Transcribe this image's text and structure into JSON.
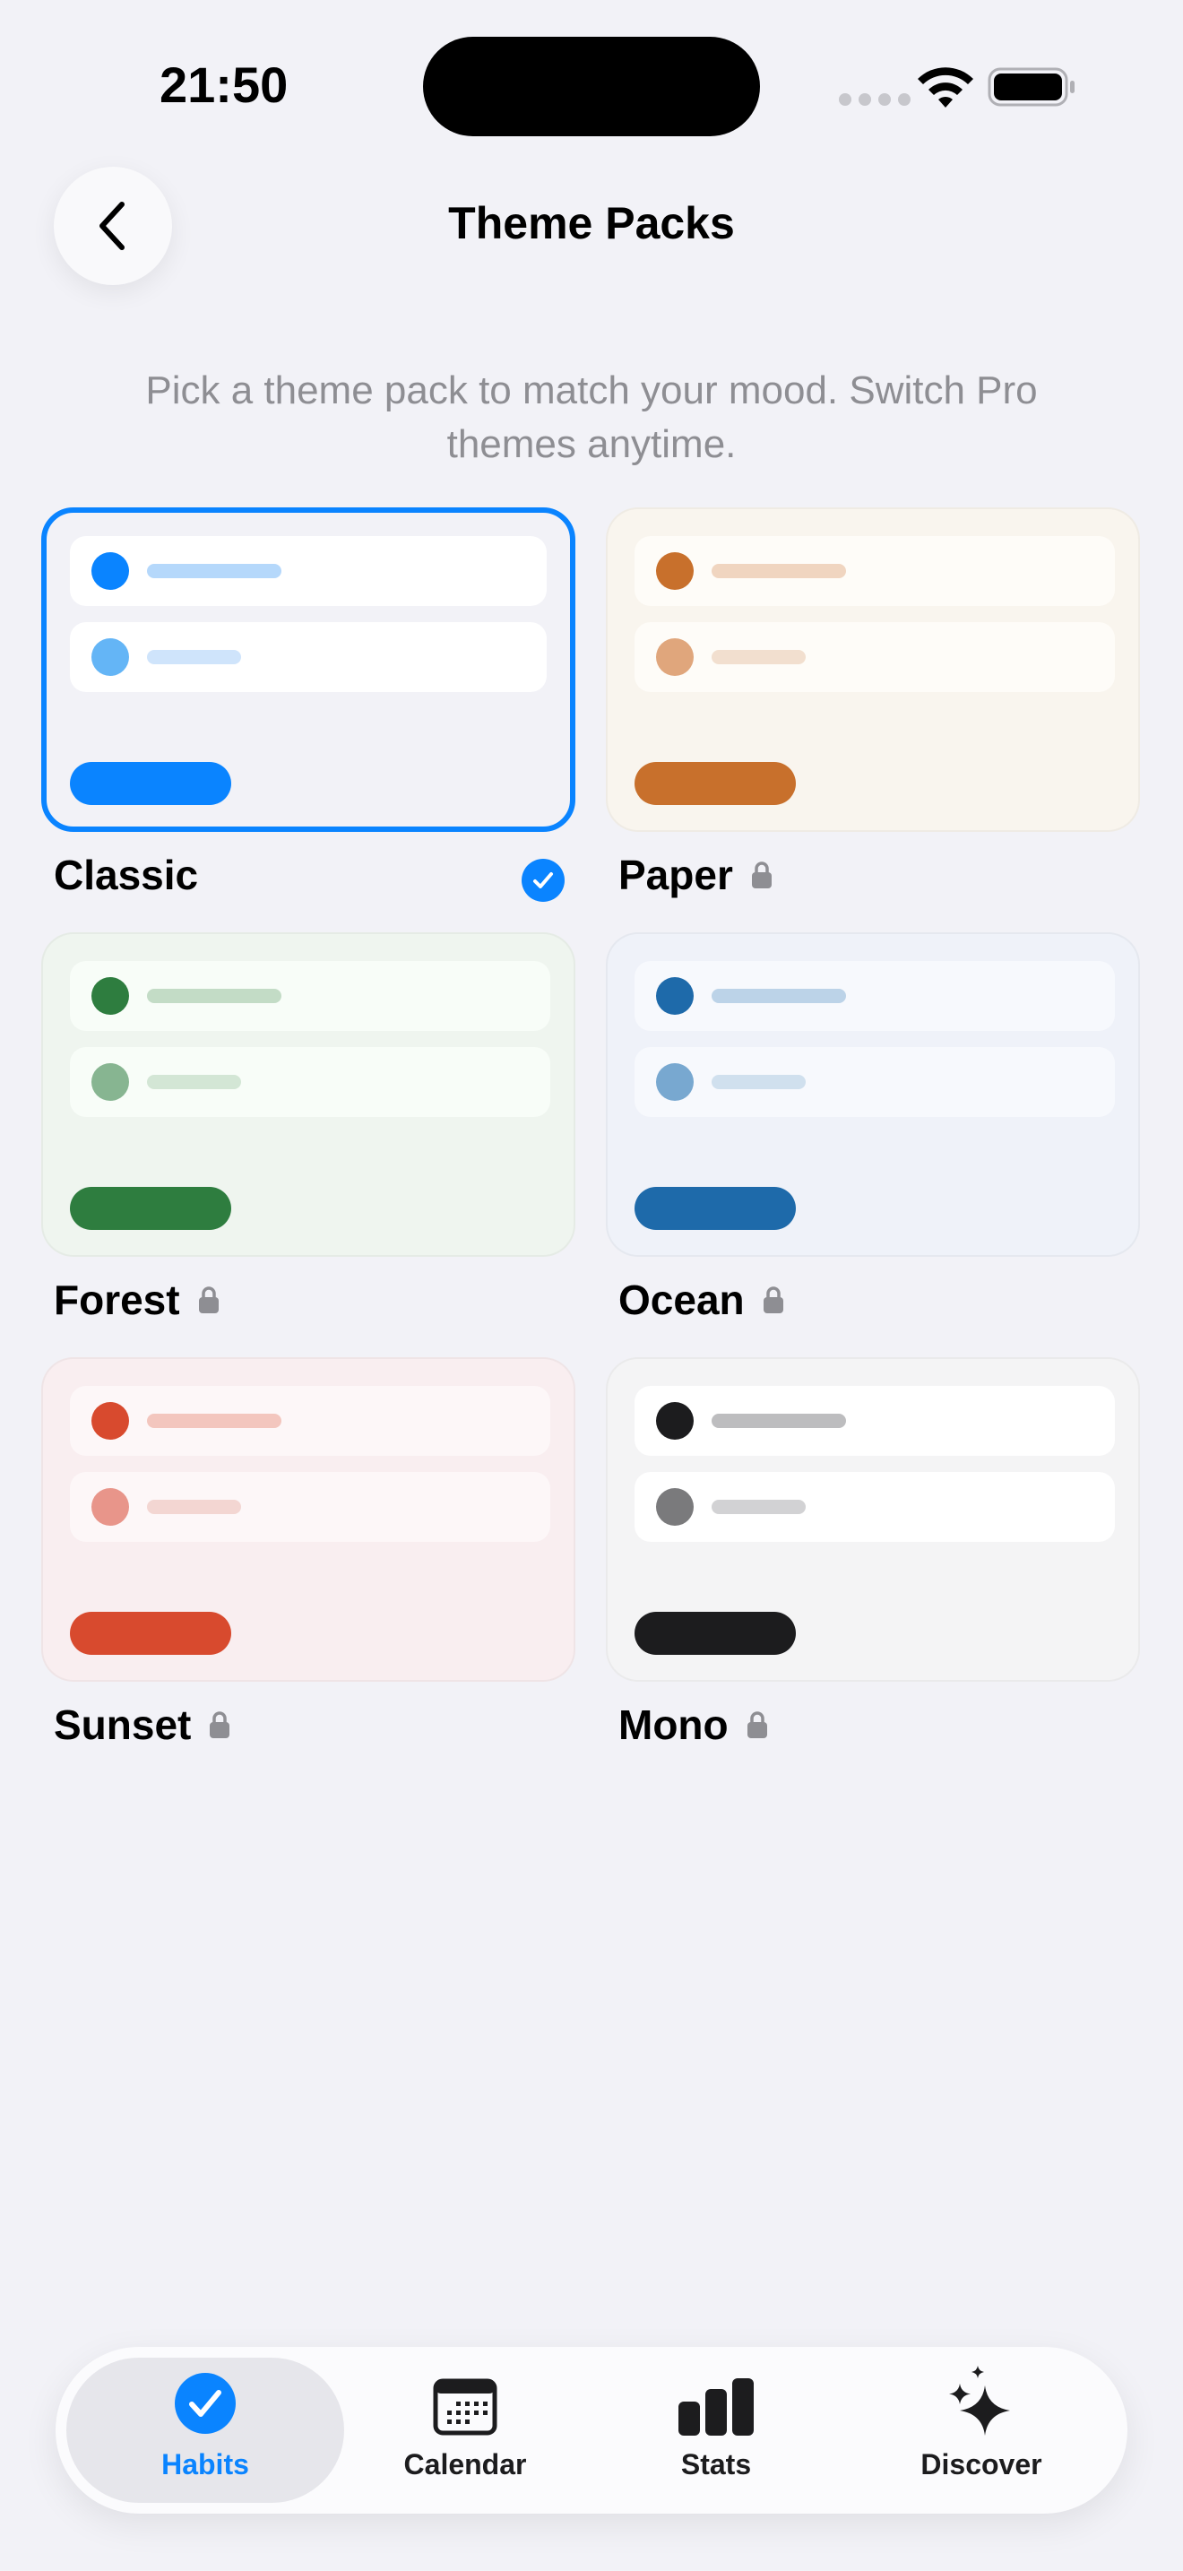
{
  "status_bar": {
    "time": "21:50"
  },
  "header": {
    "title": "Theme Packs",
    "back_icon": "chevron-left-icon"
  },
  "subtitle": "Pick a theme pack to match your mood. Switch Pro themes anytime.",
  "colors": {
    "accent": "#0a84ff",
    "background": "#f2f2f7",
    "lock": "#8e8e93"
  },
  "themes": [
    {
      "name": "Classic",
      "selected": true,
      "locked": false,
      "colors": {
        "card": "#f2f2f7",
        "row": "#ffffff",
        "dot1": "#0a84ff",
        "bar1": "#b5d8fb",
        "dot2": "#64b5f6",
        "bar2": "#cfe4fb",
        "pill": "#0a84ff"
      }
    },
    {
      "name": "Paper",
      "selected": false,
      "locked": true,
      "colors": {
        "card": "#f9f5ee",
        "row": "#fefcf8",
        "dot1": "#c8702c",
        "bar1": "#f0d5c0",
        "dot2": "#e0a67c",
        "bar2": "#f2dfcf",
        "pill": "#c8702c"
      }
    },
    {
      "name": "Forest",
      "selected": false,
      "locked": true,
      "colors": {
        "card": "#eff5ef",
        "row": "#f8fdf8",
        "dot1": "#2e7d3f",
        "bar1": "#c3dcc6",
        "dot2": "#87b591",
        "bar2": "#d3e6d5",
        "pill": "#2e7d3f"
      }
    },
    {
      "name": "Ocean",
      "selected": false,
      "locked": true,
      "colors": {
        "card": "#eff2f9",
        "row": "#f7f9fd",
        "dot1": "#1e6aaa",
        "bar1": "#bcd3e8",
        "dot2": "#78a8d0",
        "bar2": "#d0e0ee",
        "pill": "#1e6aaa"
      }
    },
    {
      "name": "Sunset",
      "selected": false,
      "locked": true,
      "colors": {
        "card": "#f9eef0",
        "row": "#fdf7f8",
        "dot1": "#d84a2e",
        "bar1": "#f3c6be",
        "dot2": "#e8958a",
        "bar2": "#f3d6d2",
        "pill": "#d84a2e"
      }
    },
    {
      "name": "Mono",
      "selected": false,
      "locked": true,
      "colors": {
        "card": "#f4f4f5",
        "row": "#ffffff",
        "dot1": "#1c1c1e",
        "bar1": "#bdbdbf",
        "dot2": "#7a7a7c",
        "bar2": "#d2d2d4",
        "pill": "#1c1c1e"
      }
    }
  ],
  "tabbar": {
    "items": [
      {
        "label": "Habits",
        "icon": "checkmark-circle-icon",
        "active": true
      },
      {
        "label": "Calendar",
        "icon": "calendar-icon",
        "active": false
      },
      {
        "label": "Stats",
        "icon": "bar-chart-icon",
        "active": false
      },
      {
        "label": "Discover",
        "icon": "sparkles-icon",
        "active": false
      }
    ]
  }
}
